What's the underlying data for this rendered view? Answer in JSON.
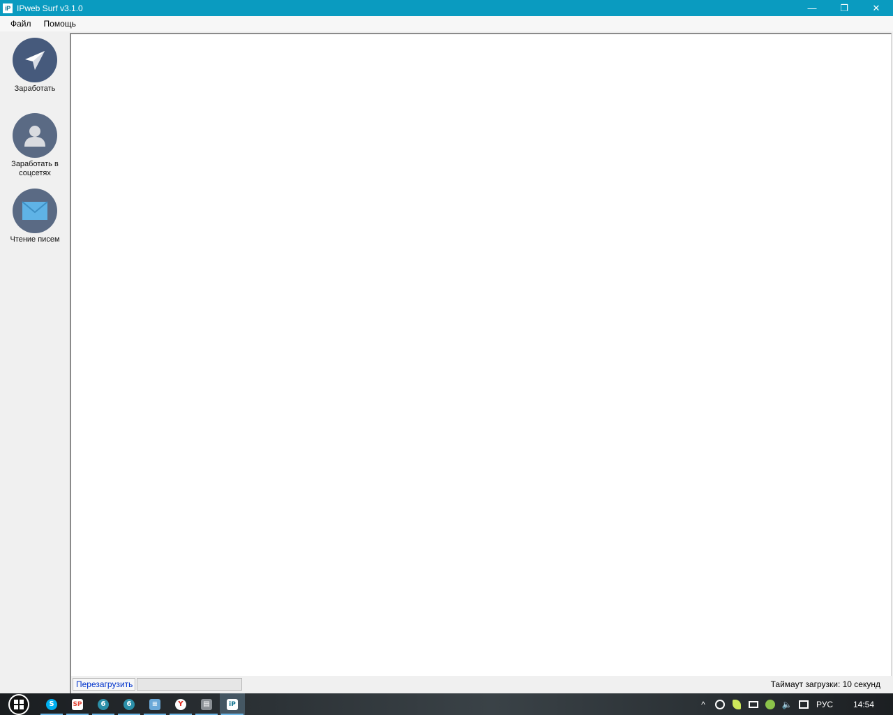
{
  "window": {
    "title": "IPweb Surf v3.1.0",
    "icon_text": "iP",
    "controls": {
      "minimize_icon": "—",
      "maximize_icon": "❐",
      "close_icon": "✕"
    }
  },
  "menu": [
    {
      "label": "Файл"
    },
    {
      "label": "Помощь"
    }
  ],
  "sidebar": {
    "items": [
      {
        "label": "Заработать",
        "icon": "paper-plane-icon"
      },
      {
        "label": "Заработать в соцсетях",
        "icon": "user-icon"
      },
      {
        "label": "Чтение писем",
        "icon": "envelope-icon"
      }
    ]
  },
  "statusbar": {
    "reload_label": "Перезагрузить",
    "timeout_text": "Таймаут загрузки: 10 секунд"
  },
  "taskbar": {
    "apps": [
      {
        "name": "skype",
        "glyph": "S",
        "color": "#00aff0"
      },
      {
        "name": "sp-app",
        "glyph": "SP",
        "color": "#e24a3b"
      },
      {
        "name": "app-6-a",
        "glyph": "6",
        "color": "#2b8fa8"
      },
      {
        "name": "app-6-b",
        "glyph": "6",
        "color": "#2b8fa8"
      },
      {
        "name": "notepad",
        "glyph": "≡",
        "color": "#6aa8d8"
      },
      {
        "name": "yandex-browser",
        "glyph": "Y",
        "color": "#e0261b"
      },
      {
        "name": "archive",
        "glyph": "▤",
        "color": "#8a8f94"
      },
      {
        "name": "ipweb",
        "glyph": "iP",
        "color": "#ffffff"
      }
    ],
    "tray": {
      "language": "РУС",
      "time": "14:54"
    },
    "colors": {
      "accent": "#0a9bc0"
    }
  }
}
